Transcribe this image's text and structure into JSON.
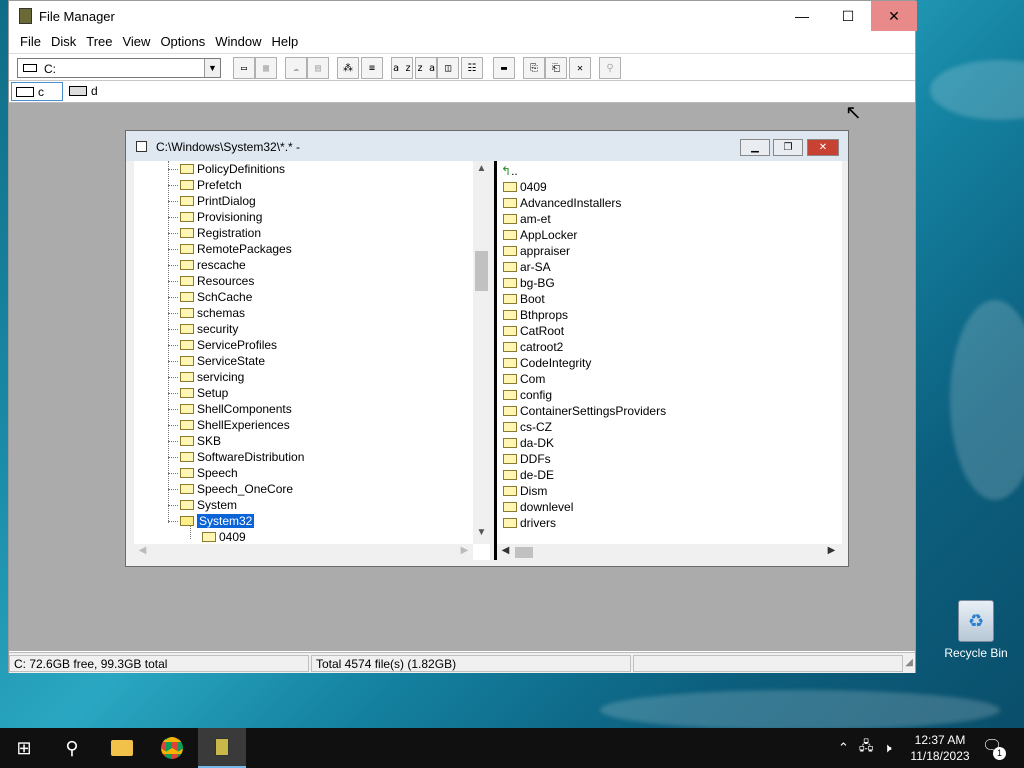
{
  "app": {
    "title": "File Manager",
    "window_controls": {
      "minimize": "—",
      "maximize": "☐",
      "close": "✕"
    }
  },
  "menubar": [
    "File",
    "Disk",
    "Tree",
    "View",
    "Options",
    "Window",
    "Help"
  ],
  "toolbar": {
    "drive_select": "C:",
    "buttons": [
      {
        "glyph": "▭",
        "disabled": false
      },
      {
        "glyph": "▦",
        "disabled": true
      },
      {
        "glyph": "☁",
        "disabled": true
      },
      {
        "glyph": "▤",
        "disabled": true
      },
      {
        "glyph": "⁂",
        "disabled": false
      },
      {
        "glyph": "≡",
        "disabled": false
      },
      {
        "glyph": "a z",
        "disabled": false
      },
      {
        "glyph": "z a",
        "disabled": false
      },
      {
        "glyph": "◫",
        "disabled": false
      },
      {
        "glyph": "☷",
        "disabled": false
      },
      {
        "glyph": "▬",
        "disabled": false
      },
      {
        "glyph": "⎘",
        "disabled": false
      },
      {
        "glyph": "⎗",
        "disabled": false
      },
      {
        "glyph": "✕",
        "disabled": false
      },
      {
        "glyph": "⚲",
        "disabled": true
      }
    ]
  },
  "drives": [
    {
      "label": "c",
      "active": true
    },
    {
      "label": "d",
      "active": false
    }
  ],
  "child_window": {
    "title": "C:\\Windows\\System32\\*.* -",
    "controls": {
      "minimize": "▁",
      "restore": "❐",
      "close": "✕"
    }
  },
  "tree": {
    "items": [
      "PolicyDefinitions",
      "Prefetch",
      "PrintDialog",
      "Provisioning",
      "Registration",
      "RemotePackages",
      "rescache",
      "Resources",
      "SchCache",
      "schemas",
      "security",
      "ServiceProfiles",
      "ServiceState",
      "servicing",
      "Setup",
      "ShellComponents",
      "ShellExperiences",
      "SKB",
      "SoftwareDistribution",
      "Speech",
      "Speech_OneCore",
      "System",
      "System32"
    ],
    "selected": "System32",
    "child": "0409"
  },
  "files": {
    "parent": "..",
    "items": [
      "0409",
      "AdvancedInstallers",
      "am-et",
      "AppLocker",
      "appraiser",
      "ar-SA",
      "bg-BG",
      "Boot",
      "Bthprops",
      "CatRoot",
      "catroot2",
      "CodeIntegrity",
      "Com",
      "config",
      "ContainerSettingsProviders",
      "cs-CZ",
      "da-DK",
      "DDFs",
      "de-DE",
      "Dism",
      "downlevel",
      "drivers"
    ]
  },
  "status": {
    "free": "C: 72.6GB free,  99.3GB total",
    "total": "Total 4574 file(s) (1.82GB)"
  },
  "desktop": {
    "recycle_bin": "Recycle Bin"
  },
  "taskbar": {
    "time": "12:37 AM",
    "date": "11/18/2023",
    "notifications": "1"
  }
}
